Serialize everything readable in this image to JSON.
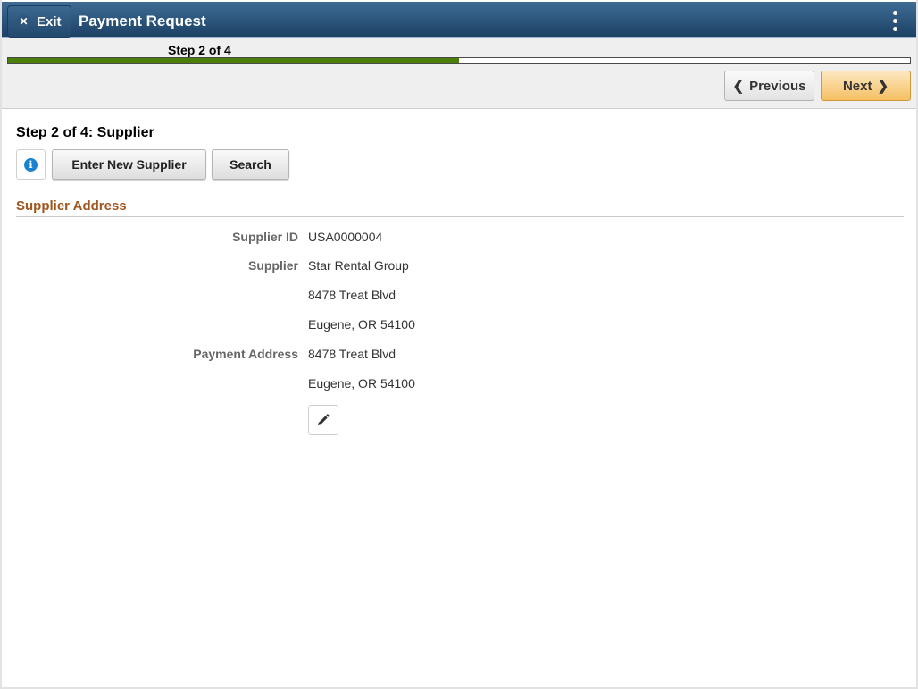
{
  "header": {
    "exit_label": "Exit",
    "title": "Payment Request",
    "menu_icon": "vertical-ellipsis-icon"
  },
  "stepbar": {
    "step_label": "Step 2 of 4",
    "progress_fraction": 0.5,
    "previous_label": "Previous",
    "next_label": "Next"
  },
  "page": {
    "heading": "Step 2 of 4: Supplier",
    "info_icon": "info-icon",
    "enter_new_supplier_label": "Enter New Supplier",
    "search_label": "Search",
    "section_title": "Supplier Address",
    "fields": [
      {
        "label": "Supplier ID",
        "value": "USA0000004"
      },
      {
        "label": "Supplier",
        "value": "Star Rental Group"
      },
      {
        "label": "",
        "value": "8478 Treat Blvd"
      },
      {
        "label": "",
        "value": "Eugene, OR  54100"
      },
      {
        "label": "Payment Address",
        "value": "8478 Treat Blvd"
      },
      {
        "label": "",
        "value": "Eugene, OR  54100"
      }
    ],
    "edit_icon": "pencil-icon"
  },
  "colors": {
    "banner": "#1c4265",
    "progress": "#4a7f0a",
    "next_button": "#f5c062",
    "section_title": "#a0561e",
    "info_icon": "#1a82cf"
  }
}
